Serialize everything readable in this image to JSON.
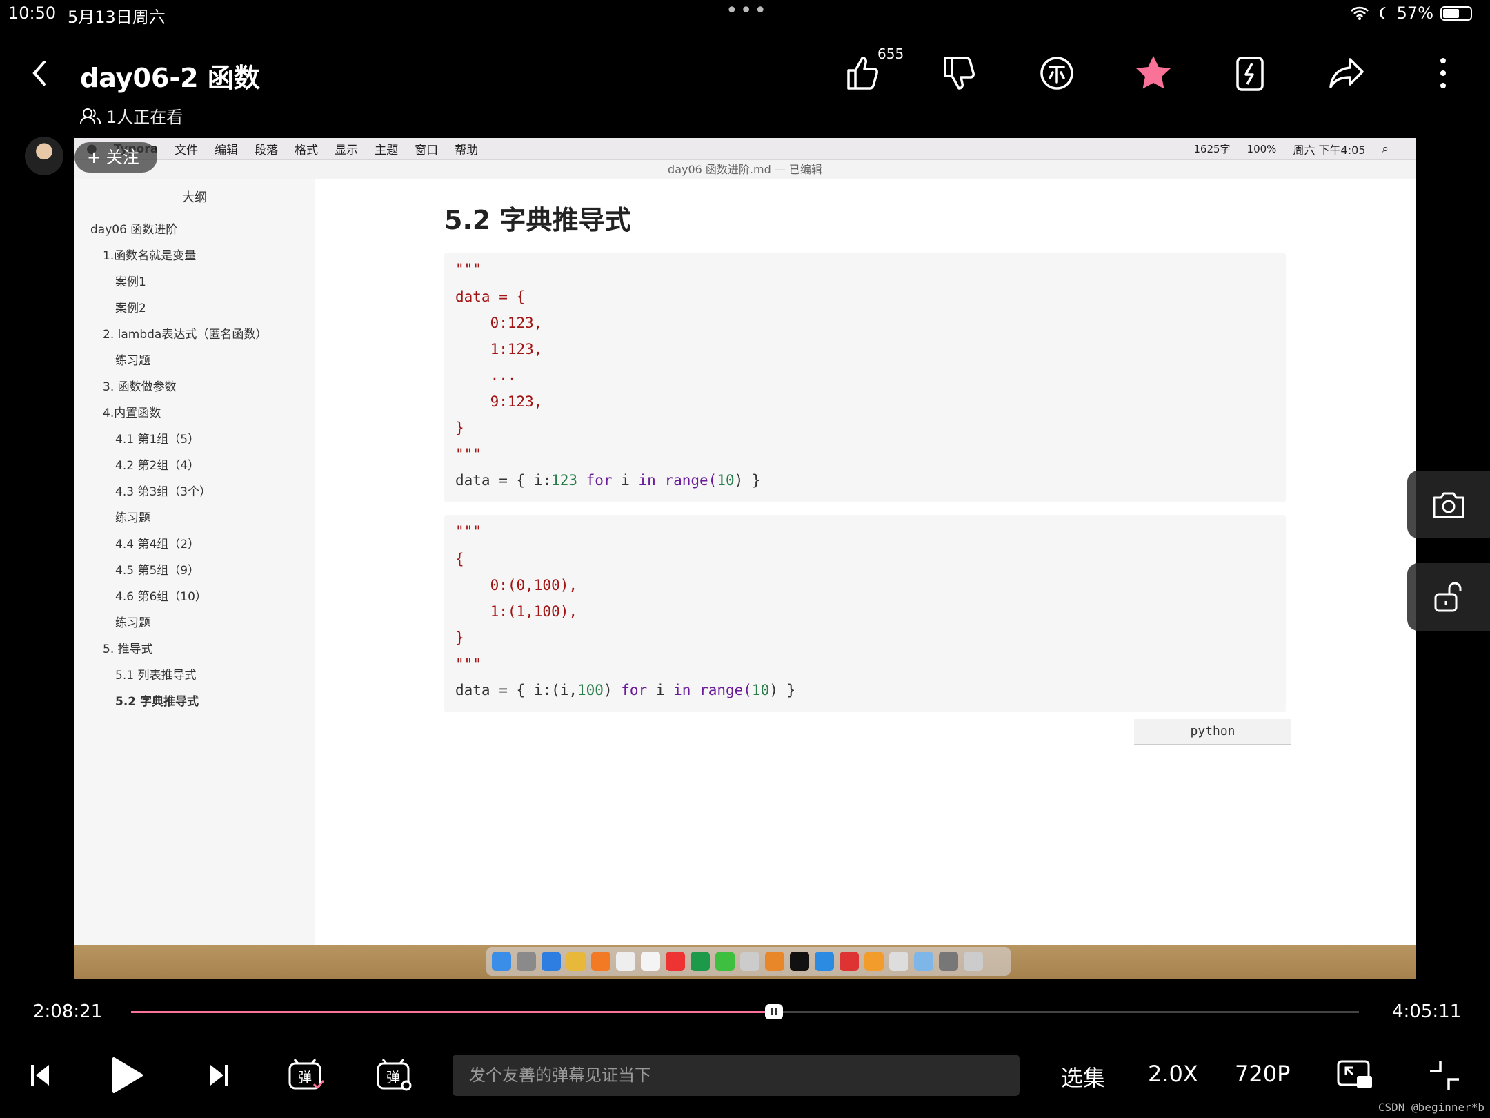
{
  "statusbar": {
    "time": "10:50",
    "date": "5月13日周六",
    "dots": "•••",
    "battery": "57%"
  },
  "header": {
    "title": "day06-2 函数",
    "viewers": "1人正在看",
    "like_count": "655"
  },
  "uploader": {
    "follow_label": "+ 关注"
  },
  "typora": {
    "menu": [
      "Typora",
      "文件",
      "编辑",
      "段落",
      "格式",
      "显示",
      "主题",
      "窗口",
      "帮助"
    ],
    "menu_right": {
      "wordcount": "1625字",
      "battery": "100%",
      "datetime": "周六 下午4:05"
    },
    "file_title": "day06 函数进阶.md — 已编辑",
    "outline_header": "大纲",
    "outline": [
      "day06 函数进阶",
      "1.函数名就是变量",
      "案例1",
      "案例2",
      "2. lambda表达式（匿名函数）",
      "练习题",
      "3. 函数做参数",
      "4.内置函数",
      "4.1 第1组（5）",
      "4.2 第2组（4）",
      "4.3 第3组（3个）",
      "练习题",
      "4.4 第4组（2）",
      "4.5 第5组（9）",
      "4.6 第6组（10）",
      "练习题",
      "5. 推导式",
      "5.1 列表推导式",
      "5.2 字典推导式"
    ],
    "heading": "5.2 字典推导式",
    "code1": {
      "q1": "\"\"\"",
      "l1": "data = {",
      "l2": "    0:123,",
      "l3": "    1:123,",
      "l4": "    ...",
      "l5": "    9:123,",
      "l6": "}",
      "q2": "\"\"\"",
      "f_data": "data = { i:",
      "f_num": "123",
      "f_for": " for ",
      "f_i": "i",
      "f_in": " in ",
      "f_range": "range(",
      "f_ten": "10",
      "f_end": ") }"
    },
    "code2": {
      "q1": "\"\"\"",
      "l1": "{",
      "l2": "    0:(0,100),",
      "l3": "    1:(1,100),",
      "l4": "}",
      "q2": "\"\"\"",
      "f_data": "data = { i:(i,",
      "f_num": "100",
      "f_close": ")",
      "f_for": " for ",
      "f_i": "i",
      "f_in": " in ",
      "f_range": "range(",
      "f_ten": "10",
      "f_end": ") }"
    },
    "lang": "python"
  },
  "player": {
    "current": "2:08:21",
    "total": "4:05:11",
    "progress": 0.5235,
    "danmu_placeholder": "发个友善的弹幕见证当下",
    "episodes": "选集",
    "speed": "2.0X",
    "quality": "720P"
  },
  "watermark": "CSDN @beginner*b",
  "colors": {
    "accent": "#fb7299",
    "star": "#fb7299"
  }
}
